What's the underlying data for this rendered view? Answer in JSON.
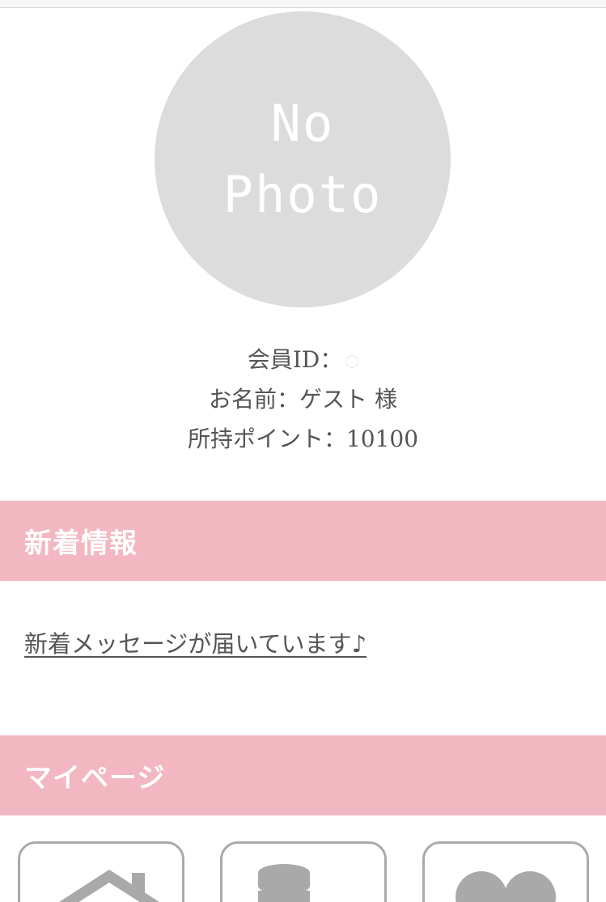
{
  "avatar": {
    "line1": "No",
    "line2": "Photo"
  },
  "member": {
    "id_label": "会員ID：",
    "name_label": "お名前：ゲスト 様",
    "points_label": "所持ポイント：10100"
  },
  "news": {
    "title": "新着情報",
    "link_text": "新着メッセージが届いています♪"
  },
  "mypage": {
    "title": "マイページ",
    "tiles": [
      {
        "icon": "home-icon"
      },
      {
        "icon": "coins-icon"
      },
      {
        "icon": "heart-icon"
      }
    ]
  },
  "colors": {
    "section_bar": "#f2b7c1",
    "avatar_bg": "#dcdcdc",
    "text": "#555555",
    "tile_border": "#a9a9a9"
  }
}
